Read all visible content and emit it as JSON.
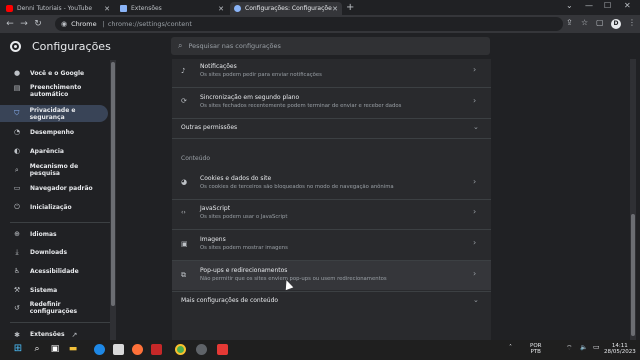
{
  "browser": {
    "tabs": [
      {
        "label": "Denni Tutoriais - YouTube",
        "color": "#ff0000"
      },
      {
        "label": "Extensões",
        "color": "#8ab4f8"
      },
      {
        "label": "Configurações: Configurações d",
        "color": "#8ab4f8"
      }
    ],
    "new_tab": "+",
    "window_controls": [
      "⌄",
      "—",
      "☐",
      "✕"
    ],
    "nav": {
      "back": "←",
      "forward": "→",
      "reload": "↻"
    },
    "address": {
      "chip": "Chrome",
      "url": "chrome://settings/content"
    },
    "toolbar_icons": [
      "⇪",
      "☆",
      "▢",
      "⋮"
    ]
  },
  "header": {
    "title": "Configurações",
    "search_placeholder": "Pesquisar nas configurações"
  },
  "sidebar": {
    "items": [
      {
        "label": "Você e o Google",
        "icon": "person-icon",
        "glyph": "●"
      },
      {
        "label": "Preenchimento automático",
        "icon": "document-icon",
        "glyph": "▤"
      },
      {
        "label": "Privacidade e segurança",
        "icon": "shield-icon",
        "glyph": "⛉"
      },
      {
        "label": "Desempenho",
        "icon": "gauge-icon",
        "glyph": "◔"
      },
      {
        "label": "Aparência",
        "icon": "palette-icon",
        "glyph": "◐"
      },
      {
        "label": "Mecanismo de pesquisa",
        "icon": "search-icon",
        "glyph": "⌕"
      },
      {
        "label": "Navegador padrão",
        "icon": "browser-icon",
        "glyph": "▭"
      },
      {
        "label": "Inicialização",
        "icon": "power-icon",
        "glyph": "⏻"
      },
      {
        "label": "Idiomas",
        "icon": "globe-icon",
        "glyph": "⊕"
      },
      {
        "label": "Downloads",
        "icon": "download-icon",
        "glyph": "⤓"
      },
      {
        "label": "Acessibilidade",
        "icon": "accessibility-icon",
        "glyph": "♿"
      },
      {
        "label": "Sistema",
        "icon": "wrench-icon",
        "glyph": "⚒"
      },
      {
        "label": "Redefinir configurações",
        "icon": "reset-icon",
        "glyph": "↺"
      },
      {
        "label": "Extensões",
        "icon": "puzzle-icon",
        "glyph": "✱"
      }
    ],
    "external_icon": "↗"
  },
  "content": {
    "rows": [
      {
        "title": "Notificações",
        "subtitle": "Os sites podem pedir para enviar notificações",
        "icon": "bell-icon",
        "glyph": "♪"
      },
      {
        "title": "Sincronização em segundo plano",
        "subtitle": "Os sites fechados recentemente podem terminar de enviar e receber dados",
        "icon": "sync-icon",
        "glyph": "⟳"
      }
    ],
    "more_permissions": "Outras permissões",
    "section_label": "Conteúdo",
    "content_rows": [
      {
        "title": "Cookies e dados do site",
        "subtitle": "Os cookies de terceiros são bloqueados no modo de navegação anônima",
        "icon": "cookie-icon",
        "glyph": "◕"
      },
      {
        "title": "JavaScript",
        "subtitle": "Os sites podem usar o JavaScript",
        "icon": "code-icon",
        "glyph": "‹›"
      },
      {
        "title": "Imagens",
        "subtitle": "Os sites podem mostrar imagens",
        "icon": "image-icon",
        "glyph": "▣"
      },
      {
        "title": "Pop-ups e redirecionamentos",
        "subtitle": "Não permitir que os sites enviem pop-ups ou usem redirecionamentos",
        "icon": "open-in-new-icon",
        "glyph": "⧉"
      }
    ],
    "more_content": "Mais configurações de conteúdo",
    "chevron": "›",
    "expand": "⌄"
  },
  "taskbar": {
    "lang": "POR",
    "lang2": "PTB",
    "time": "14:11",
    "date": "28/05/2023",
    "wifi": "⌔",
    "volume": "🔈",
    "battery": "▭",
    "chevron_up": "˄"
  }
}
